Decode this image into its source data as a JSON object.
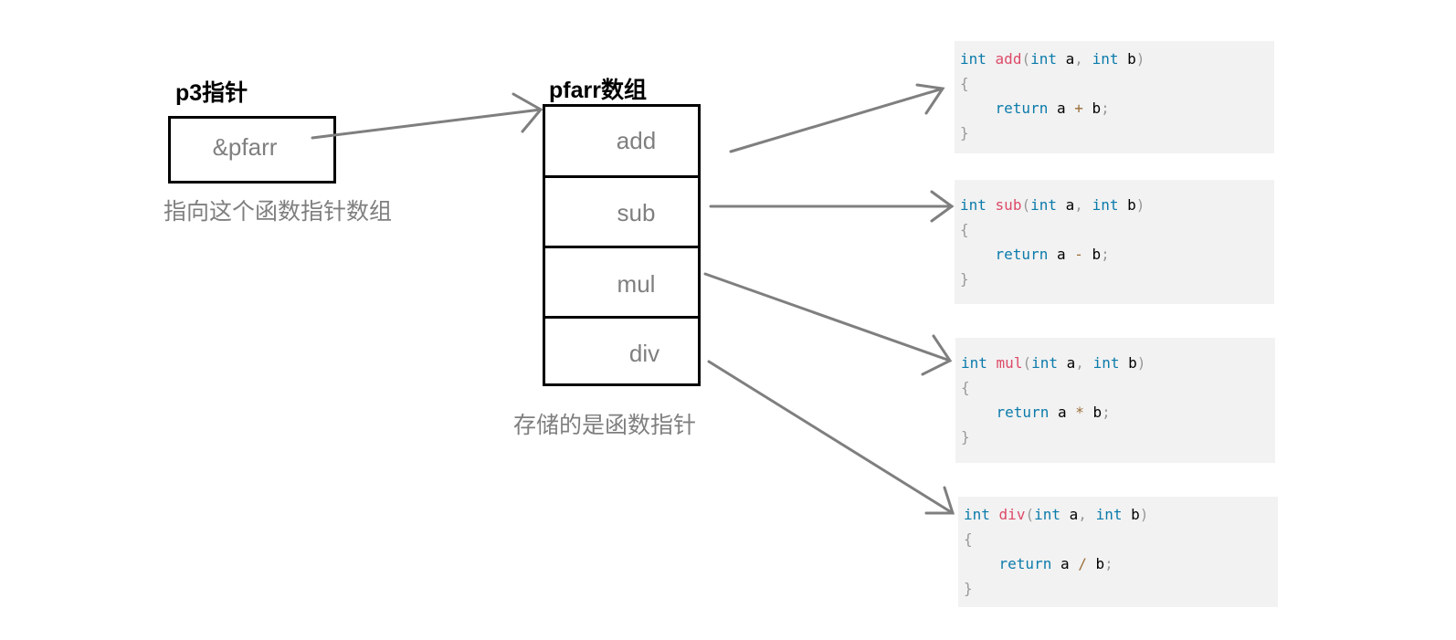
{
  "pointer": {
    "title": "p3指针",
    "value": "&pfarr",
    "note": "指向这个函数指针数组"
  },
  "array": {
    "title": "pfarr数组",
    "cells": [
      "add",
      "sub",
      "mul",
      "div"
    ],
    "note": "存储的是函数指针"
  },
  "functions": [
    {
      "kw": "int",
      "name": "add",
      "params": [
        "int",
        "a",
        "int",
        "b"
      ],
      "ret": "return",
      "op": "+"
    },
    {
      "kw": "int",
      "name": "sub",
      "params": [
        "int",
        "a",
        "int",
        "b"
      ],
      "ret": "return",
      "op": "-"
    },
    {
      "kw": "int",
      "name": "mul",
      "params": [
        "int",
        "a",
        "int",
        "b"
      ],
      "ret": "return",
      "op": "*"
    },
    {
      "kw": "int",
      "name": "div",
      "params": [
        "int",
        "a",
        "int",
        "b"
      ],
      "ret": "return",
      "op": "/"
    }
  ],
  "colors": {
    "arrow": "#7f7f7f",
    "keyword": "#0b7bab",
    "function_name": "#dd4a68",
    "operator": "#9a6e3a",
    "code_bg": "#f2f2f2"
  }
}
